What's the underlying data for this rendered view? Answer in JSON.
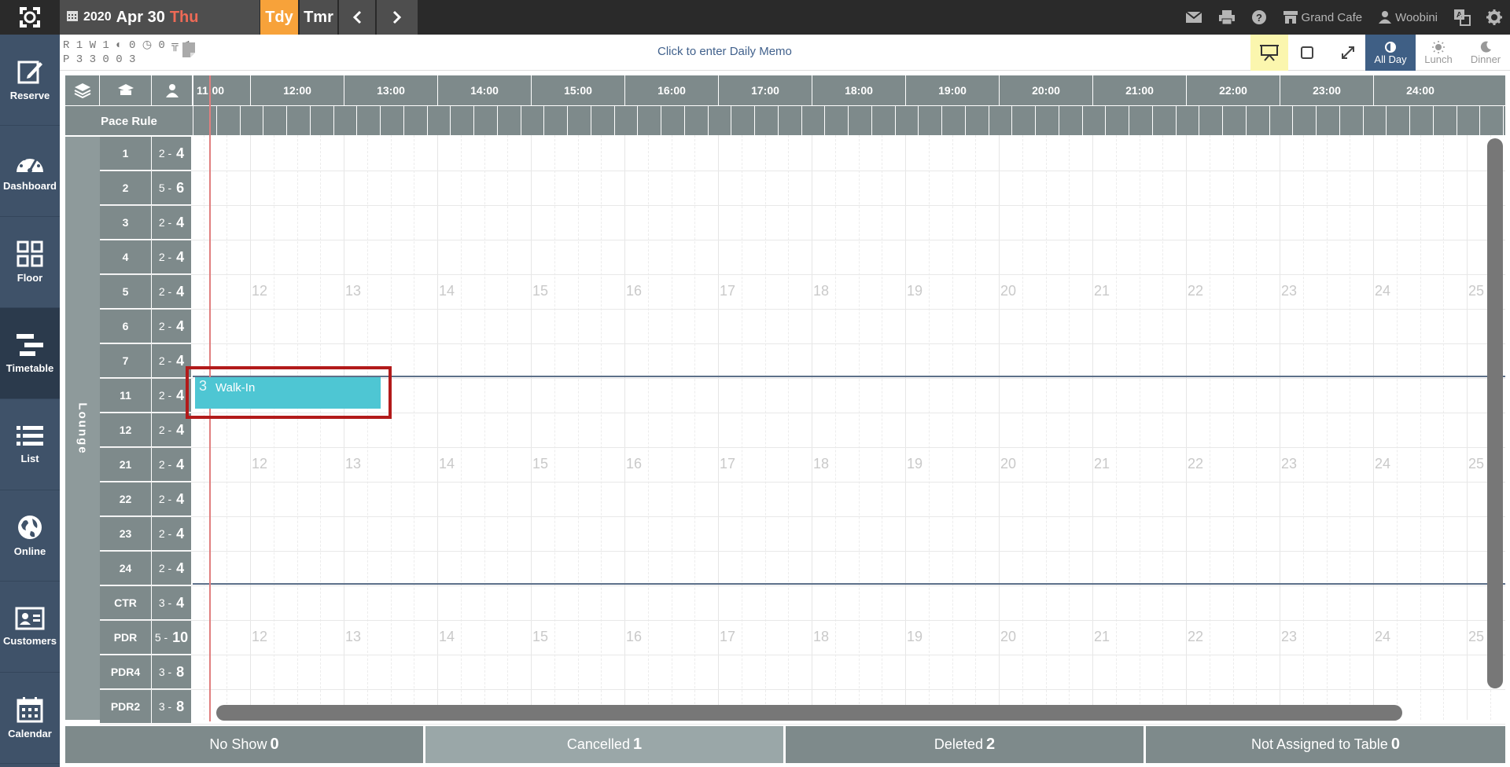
{
  "header": {
    "year": "2020",
    "month_day": "Apr 30",
    "weekday": "Thu",
    "today_label": "Tdy",
    "tomorrow_label": "Tmr",
    "restaurant": "Grand Cafe",
    "user": "Woobini"
  },
  "counts": {
    "line1": "R 1 W 1 ◐ 0 ◷ 0 ╦ 1",
    "line2": "P 3   3   0   0   3"
  },
  "memo": "Click to enter Daily Memo",
  "view_buttons": {
    "all_day": "All Day",
    "lunch": "Lunch",
    "dinner": "Dinner"
  },
  "sidebar": [
    {
      "label": "Reserve",
      "icon": "edit-icon"
    },
    {
      "label": "Dashboard",
      "icon": "gauge-icon"
    },
    {
      "label": "Floor",
      "icon": "grid-icon"
    },
    {
      "label": "Timetable",
      "icon": "timetable-icon"
    },
    {
      "label": "List",
      "icon": "list-icon"
    },
    {
      "label": "Online",
      "icon": "globe-icon"
    },
    {
      "label": "Customers",
      "icon": "id-card-icon"
    },
    {
      "label": "Calendar",
      "icon": "calendar-icon"
    }
  ],
  "timeline": {
    "first_hour": "11:00",
    "hours": [
      "12:00",
      "13:00",
      "14:00",
      "15:00",
      "16:00",
      "17:00",
      "18:00",
      "19:00",
      "20:00",
      "21:00",
      "22:00",
      "23:00",
      "24:00"
    ],
    "faint_numbers": [
      "12",
      "13",
      "14",
      "15",
      "16",
      "17",
      "18",
      "19",
      "20",
      "21",
      "22",
      "23",
      "24",
      "25"
    ]
  },
  "pace_rule_label": "Pace Rule",
  "section": "Lounge",
  "tables": [
    {
      "name": "1",
      "min": "2",
      "max": "4"
    },
    {
      "name": "2",
      "min": "5",
      "max": "6"
    },
    {
      "name": "3",
      "min": "2",
      "max": "4"
    },
    {
      "name": "4",
      "min": "2",
      "max": "4"
    },
    {
      "name": "5",
      "min": "2",
      "max": "4"
    },
    {
      "name": "6",
      "min": "2",
      "max": "4"
    },
    {
      "name": "7",
      "min": "2",
      "max": "4"
    },
    {
      "name": "11",
      "min": "2",
      "max": "4"
    },
    {
      "name": "12",
      "min": "2",
      "max": "4"
    },
    {
      "name": "21",
      "min": "2",
      "max": "4"
    },
    {
      "name": "22",
      "min": "2",
      "max": "4"
    },
    {
      "name": "23",
      "min": "2",
      "max": "4"
    },
    {
      "name": "24",
      "min": "2",
      "max": "4"
    },
    {
      "name": "CTR",
      "min": "3",
      "max": "4"
    },
    {
      "name": "PDR",
      "min": "5",
      "max": "10"
    },
    {
      "name": "PDR4",
      "min": "3",
      "max": "8"
    },
    {
      "name": "PDR2",
      "min": "3",
      "max": "8"
    }
  ],
  "reservation": {
    "party": "3",
    "name": "Walk-In",
    "table": "11"
  },
  "footer": [
    {
      "label": "No Show",
      "count": "0"
    },
    {
      "label": "Cancelled",
      "count": "1"
    },
    {
      "label": "Deleted",
      "count": "2"
    },
    {
      "label": "Not Assigned to Table",
      "count": "0"
    }
  ],
  "colors": {
    "accent": "#f7a23a",
    "sidebar": "#3f5269",
    "reservation": "#4ec6d3",
    "highlight": "#b21a1a"
  }
}
